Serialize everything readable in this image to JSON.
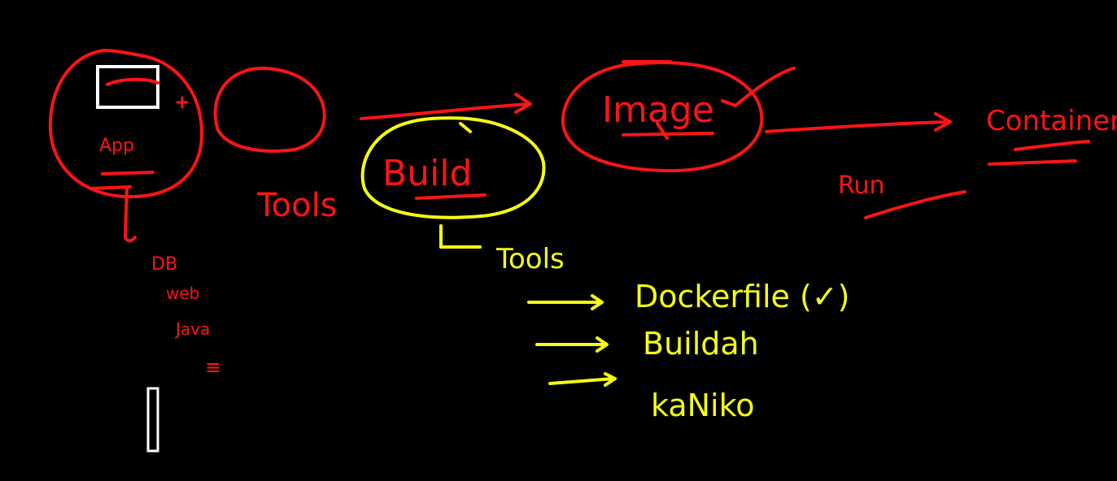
{
  "colors": {
    "background": "#000000",
    "red": "#ff1414",
    "yellow": "#f6ff14",
    "white": "#ffffff"
  },
  "labels": {
    "app": "App",
    "tools_left": "Tools",
    "build": "Build",
    "image": "Image",
    "container": "Container",
    "run": "Run",
    "tools_sub": "Tools",
    "dockerfile": "Dockerfile (✓)",
    "buildah": "Buildah",
    "kaniko": "kaNiko"
  },
  "app_components": [
    "DB",
    "web",
    "Java",
    "≡"
  ]
}
